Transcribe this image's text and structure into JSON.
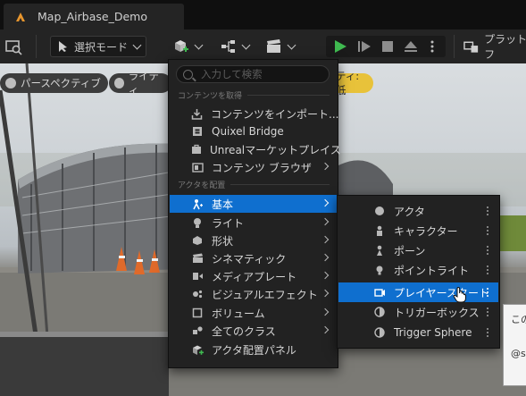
{
  "tab": {
    "title": "Map_Airbase_Demo"
  },
  "toolbar": {
    "select_mode": "選択モード",
    "platform": "プラットフ"
  },
  "viewport": {
    "chips": [
      {
        "label": "パースペクティブ"
      },
      {
        "label": "ライティ"
      },
      {
        "label": "ティ:低"
      }
    ]
  },
  "add_menu": {
    "search_placeholder": "入力して検索",
    "section_get_content": "コンテンツを取得",
    "section_place_actors": "アクタを配置",
    "items": [
      {
        "label": "コンテンツをインポート..."
      },
      {
        "label": "Quixel Bridge"
      },
      {
        "label": "Unrealマーケットプレイス"
      },
      {
        "label": "コンテンツ ブラウザ"
      },
      {
        "label": "基本"
      },
      {
        "label": "ライト"
      },
      {
        "label": "形状"
      },
      {
        "label": "シネマティック"
      },
      {
        "label": "メディアプレート"
      },
      {
        "label": "ビジュアルエフェクト"
      },
      {
        "label": "ボリューム"
      },
      {
        "label": "全てのクラス"
      },
      {
        "label": "アクタ配置パネル"
      }
    ]
  },
  "basic_submenu": {
    "items": [
      {
        "label": "アクタ"
      },
      {
        "label": "キャラクター"
      },
      {
        "label": "ポーン"
      },
      {
        "label": "ポイントライト"
      },
      {
        "label": "プレイヤースタート"
      },
      {
        "label": "トリガーボックス"
      },
      {
        "label": "Trigger Sphere"
      }
    ]
  },
  "tooltip": {
    "line1": "この",
    "line2": "@s"
  },
  "colors": {
    "accent": "#0f6fcf",
    "play_green": "#3fb950",
    "quality_chip": "#e8c23a"
  }
}
